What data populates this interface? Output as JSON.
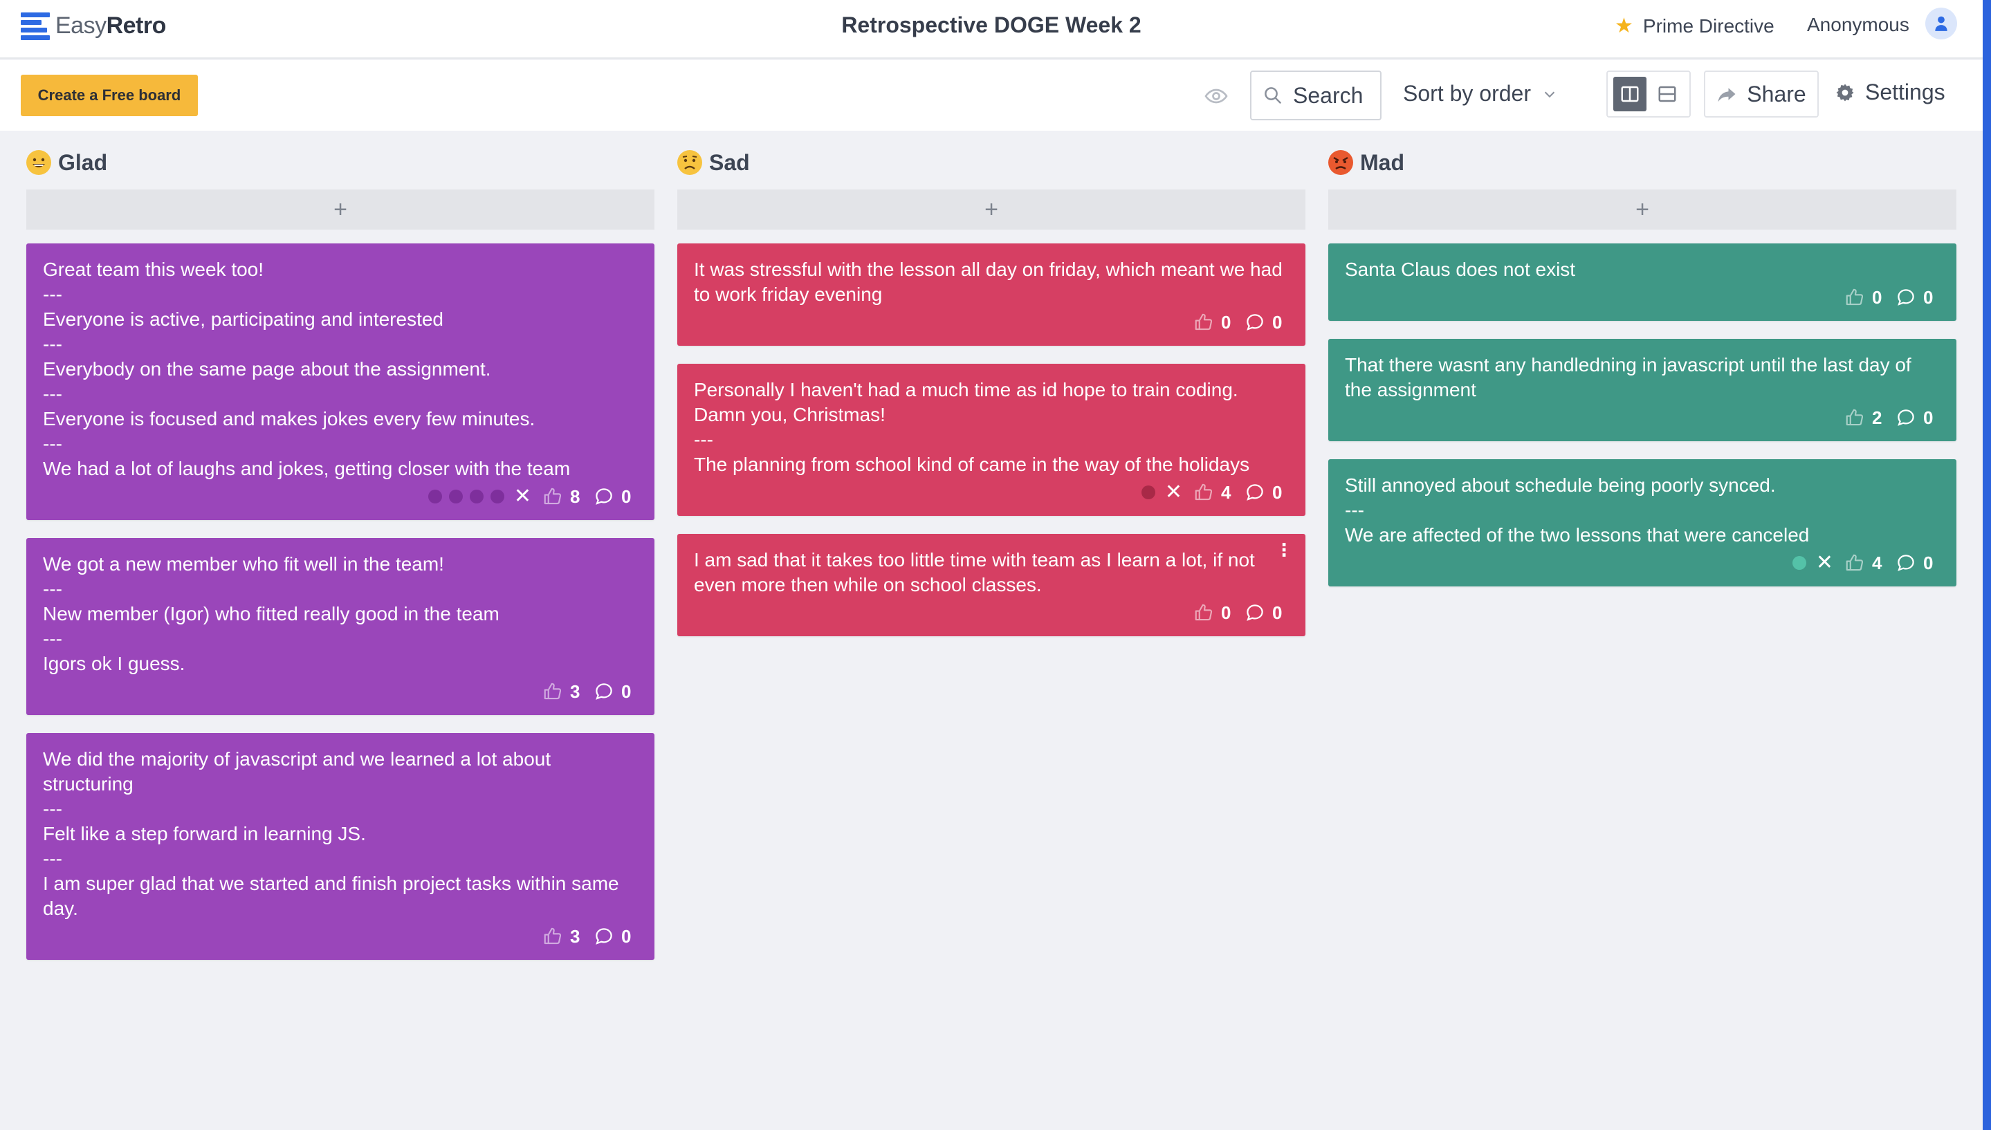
{
  "app": {
    "brand_light": "Easy",
    "brand_bold": "Retro",
    "board_title": "Retrospective DOGE Week 2",
    "prime_directive": "Prime Directive",
    "user": "Anonymous"
  },
  "toolbar": {
    "create_label": "Create a Free board",
    "search_label": "Search",
    "sort_label": "Sort by order",
    "share_label": "Share",
    "settings_label": "Settings"
  },
  "colors": {
    "glad": "#9a46ba",
    "sad": "#d63f63",
    "mad": "#3f9886",
    "accent": "#2d6ae3",
    "create_button": "#f6b93b"
  },
  "columns": [
    {
      "title": "Glad",
      "emoji": "grinning-face-icon",
      "add_label": "+",
      "cards": [
        {
          "lines": [
            "Great team this week too!",
            "---",
            "Everyone is active, participating and interested",
            "---",
            "Everybody on the same page about the assignment.",
            "---",
            "Everyone is focused and makes jokes every few minutes.",
            "---",
            "We had a lot of laughs and jokes, getting closer with the team"
          ],
          "votes": "8",
          "comments": "0",
          "dots": 4,
          "merged": true
        },
        {
          "lines": [
            "We got a new member who fit well in the team!",
            "---",
            "New member (Igor) who fitted really good in the team",
            "---",
            "Igors ok I guess."
          ],
          "votes": "3",
          "comments": "0",
          "dots": 0,
          "merged": false
        },
        {
          "lines": [
            "We did the majority of javascript and we learned a lot about structuring",
            "---",
            "Felt like a step forward in learning JS.",
            "---",
            "I am super glad that we started and finish project tasks within same day."
          ],
          "votes": "3",
          "comments": "0",
          "dots": 0,
          "merged": false
        }
      ]
    },
    {
      "title": "Sad",
      "emoji": "sad-face-icon",
      "add_label": "+",
      "cards": [
        {
          "lines": [
            "It was stressful with the lesson all day on friday, which meant we had to work friday evening"
          ],
          "votes": "0",
          "comments": "0",
          "dots": 0,
          "merged": false
        },
        {
          "lines": [
            "Personally I haven't had a much time as id hope to train coding. Damn you, Christmas!",
            "---",
            "The planning from school kind of came in the way of the holidays"
          ],
          "votes": "4",
          "comments": "0",
          "dots": 1,
          "merged": true
        },
        {
          "lines": [
            "I am sad that it takes too little time with team as I learn a lot, if not even more then while on school classes."
          ],
          "votes": "0",
          "comments": "0",
          "dots": 0,
          "merged": false,
          "menu": true
        }
      ]
    },
    {
      "title": "Mad",
      "emoji": "angry-face-icon",
      "add_label": "+",
      "cards": [
        {
          "lines": [
            "Santa Claus does not exist"
          ],
          "votes": "0",
          "comments": "0",
          "dots": 0,
          "merged": false
        },
        {
          "lines": [
            "That there wasnt any handledning in javascript until the last day of the assignment"
          ],
          "votes": "2",
          "comments": "0",
          "dots": 0,
          "merged": false
        },
        {
          "lines": [
            "Still annoyed about schedule being poorly synced.",
            "---",
            "We are affected of the two lessons that were canceled"
          ],
          "votes": "4",
          "comments": "0",
          "dots": 1,
          "merged": true
        }
      ]
    }
  ]
}
